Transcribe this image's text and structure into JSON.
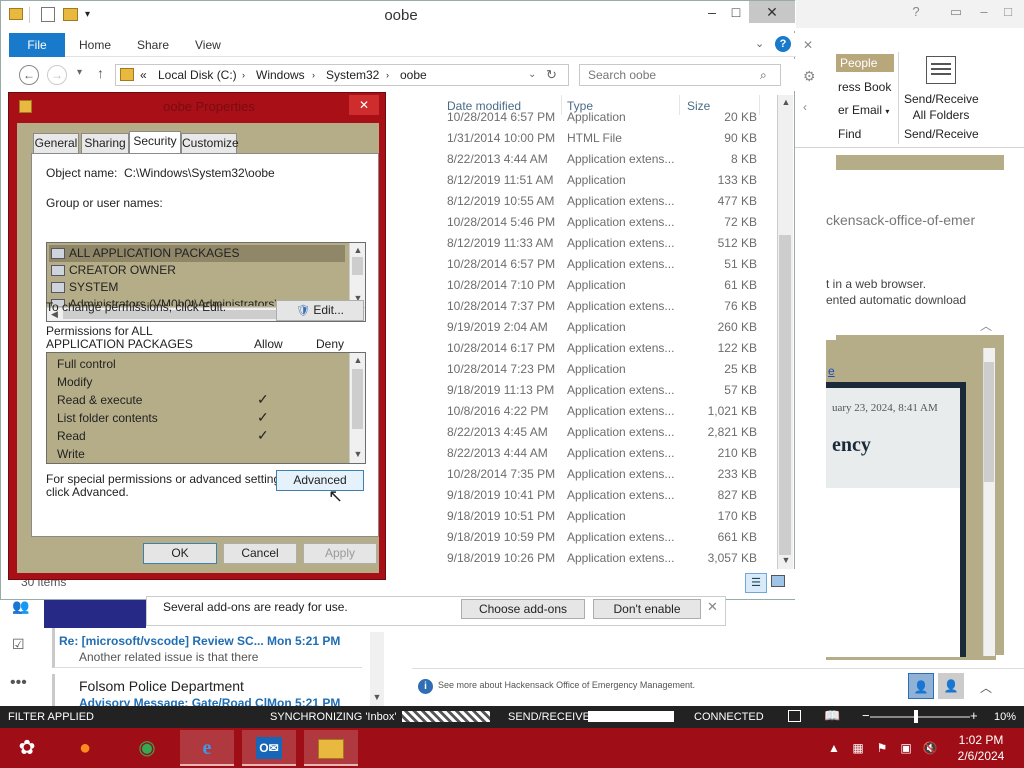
{
  "colors": {
    "accent": "#1979ca",
    "dialog_frame": "#a80f16",
    "list_bg": "#b5ad87",
    "taskbar": "#9f0e16"
  },
  "outlook": {
    "people": "People",
    "address_book": "ress Book",
    "filter_email": "er Email",
    "find": "Find",
    "send_receive": "Send/Receive",
    "all_folders": "All Folders",
    "send_receive_group": "Send/Receive",
    "reading_url": "ckensack-office-of-emer",
    "reading_text1": "t in a web browser.",
    "reading_text2": "ented automatic download",
    "msg_date": "uary 23, 2024, 8:41 AM",
    "msg_heading": "ency",
    "msg_link": "e",
    "info_text": "See more about Hackensack Office of Emergency Management.",
    "mail": [
      {
        "from": "Re: [microsoft/vscode] Review SC...",
        "time": "Mon 5:21 PM",
        "body": "Another related issue is that there"
      },
      {
        "from": "Folsom Police Department",
        "time": "Mon 5:21 PM",
        "body": "Advisory Message: Gate/Road Cl..."
      }
    ],
    "status": {
      "filter": "FILTER APPLIED",
      "sync": "SYNCHRONIZING 'Inbox'",
      "send_receive": "SEND/RECEIVE",
      "connected": "CONNECTED",
      "zoom": "10%"
    }
  },
  "explorer": {
    "title": "oobe",
    "tabs": {
      "file": "File",
      "home": "Home",
      "share": "Share",
      "view": "View"
    },
    "path": {
      "sep": "«",
      "disk": "Local Disk (C:)",
      "windows": "Windows",
      "system32": "System32",
      "oobe": "oobe"
    },
    "search_placeholder": "Search oobe",
    "columns": {
      "date": "Date modified",
      "type": "Type",
      "size": "Size"
    },
    "rows": [
      {
        "date": "10/28/2014 6:57 PM",
        "type": "Application",
        "size": "20 KB"
      },
      {
        "date": "1/31/2014 10:00 PM",
        "type": "HTML File",
        "size": "90 KB"
      },
      {
        "date": "8/22/2013 4:44 AM",
        "type": "Application extens...",
        "size": "8 KB"
      },
      {
        "date": "8/12/2019 11:51 AM",
        "type": "Application",
        "size": "133 KB"
      },
      {
        "date": "8/12/2019 10:55 AM",
        "type": "Application extens...",
        "size": "477 KB"
      },
      {
        "date": "10/28/2014 5:46 PM",
        "type": "Application extens...",
        "size": "72 KB"
      },
      {
        "date": "8/12/2019 11:33 AM",
        "type": "Application extens...",
        "size": "512 KB"
      },
      {
        "date": "10/28/2014 6:57 PM",
        "type": "Application extens...",
        "size": "51 KB"
      },
      {
        "date": "10/28/2014 7:10 PM",
        "type": "Application",
        "size": "61 KB"
      },
      {
        "date": "10/28/2014 7:37 PM",
        "type": "Application extens...",
        "size": "76 KB"
      },
      {
        "date": "9/19/2019 2:04 AM",
        "type": "Application",
        "size": "260 KB"
      },
      {
        "date": "10/28/2014 6:17 PM",
        "type": "Application extens...",
        "size": "122 KB"
      },
      {
        "date": "10/28/2014 7:23 PM",
        "type": "Application",
        "size": "25 KB"
      },
      {
        "date": "9/18/2019 11:13 PM",
        "type": "Application extens...",
        "size": "57 KB"
      },
      {
        "date": "10/8/2016 4:22 PM",
        "type": "Application extens...",
        "size": "1,021 KB"
      },
      {
        "date": "8/22/2013 4:45 AM",
        "type": "Application extens...",
        "size": "2,821 KB"
      },
      {
        "date": "8/22/2013 4:44 AM",
        "type": "Application extens...",
        "size": "210 KB"
      },
      {
        "date": "10/28/2014 7:35 PM",
        "type": "Application extens...",
        "size": "233 KB"
      },
      {
        "date": "9/18/2019 10:41 PM",
        "type": "Application extens...",
        "size": "827 KB"
      },
      {
        "date": "9/18/2019 10:51 PM",
        "type": "Application",
        "size": "170 KB"
      },
      {
        "date": "9/18/2019 10:59 PM",
        "type": "Application extens...",
        "size": "661 KB"
      },
      {
        "date": "9/18/2019 10:26 PM",
        "type": "Application extens...",
        "size": "3,057 KB"
      }
    ],
    "item_count": "30 items"
  },
  "notification": {
    "text": "Several add-ons are ready for use.",
    "choose": "Choose add-ons",
    "dont": "Don't enable"
  },
  "dialog": {
    "title": "oobe Properties",
    "tabs": {
      "general": "General",
      "sharing": "Sharing",
      "security": "Security",
      "customize": "Customize"
    },
    "object_label": "Object name:",
    "object_value": "C:\\Windows\\System32\\oobe",
    "group_label": "Group or user names:",
    "users": [
      "ALL APPLICATION PACKAGES",
      "CREATOR OWNER",
      "SYSTEM",
      "Administrators (VM0b0t\\Administrators)"
    ],
    "change_text": "To change permissions, click Edit.",
    "edit": "Edit...",
    "perms_for_1": "Permissions for ALL",
    "perms_for_2": "APPLICATION PACKAGES",
    "allow": "Allow",
    "deny": "Deny",
    "permissions": [
      {
        "name": "Full control",
        "allow": "",
        "deny": ""
      },
      {
        "name": "Modify",
        "allow": "",
        "deny": ""
      },
      {
        "name": "Read & execute",
        "allow": "✓",
        "deny": ""
      },
      {
        "name": "List folder contents",
        "allow": "✓",
        "deny": ""
      },
      {
        "name": "Read",
        "allow": "✓",
        "deny": ""
      },
      {
        "name": "Write",
        "allow": "",
        "deny": ""
      }
    ],
    "special_1": "For special permissions or advanced settings,",
    "special_2": "click Advanced.",
    "advanced": "Advanced",
    "ok": "OK",
    "cancel": "Cancel",
    "apply": "Apply"
  },
  "taskbar": {
    "time": "1:02 PM",
    "date": "2/6/2024"
  }
}
